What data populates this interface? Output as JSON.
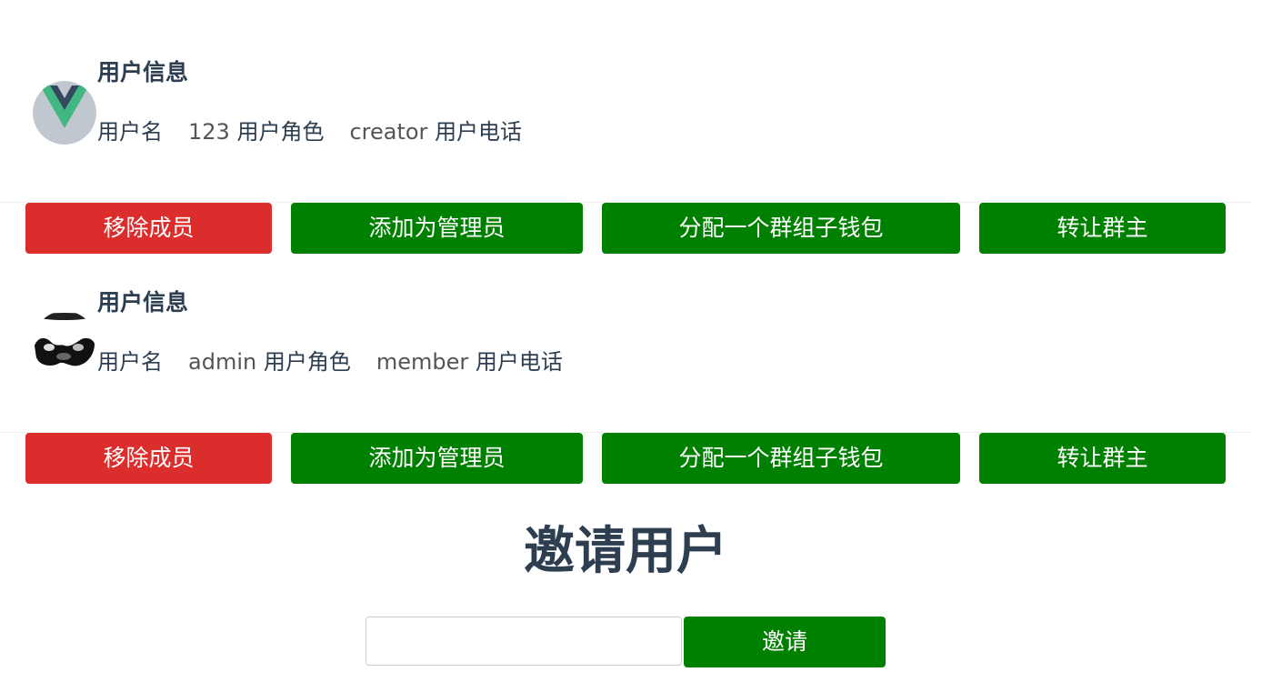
{
  "members": [
    {
      "section_title": "用户信息",
      "username_label": "用户名",
      "username": "123",
      "role_label": "用户角色",
      "role": "creator",
      "phone_label": "用户电话",
      "phone": "",
      "avatar_icon": "vue-logo-icon",
      "actions": {
        "remove": "移除成员",
        "make_admin": "添加为管理员",
        "assign_wallet": "分配一个群组子钱包",
        "transfer_owner": "转让群主"
      }
    },
    {
      "section_title": "用户信息",
      "username_label": "用户名",
      "username": "admin",
      "role_label": "用户角色",
      "role": "member",
      "phone_label": "用户电话",
      "phone": "",
      "avatar_icon": "user-photo-avatar",
      "actions": {
        "remove": "移除成员",
        "make_admin": "添加为管理员",
        "assign_wallet": "分配一个群组子钱包",
        "transfer_owner": "转让群主"
      }
    }
  ],
  "invite": {
    "title": "邀请用户",
    "input_value": "",
    "input_placeholder": "",
    "button_label": "邀请"
  },
  "colors": {
    "danger": "#dc2d2d",
    "success": "#008000",
    "text": "#2c3e50"
  }
}
